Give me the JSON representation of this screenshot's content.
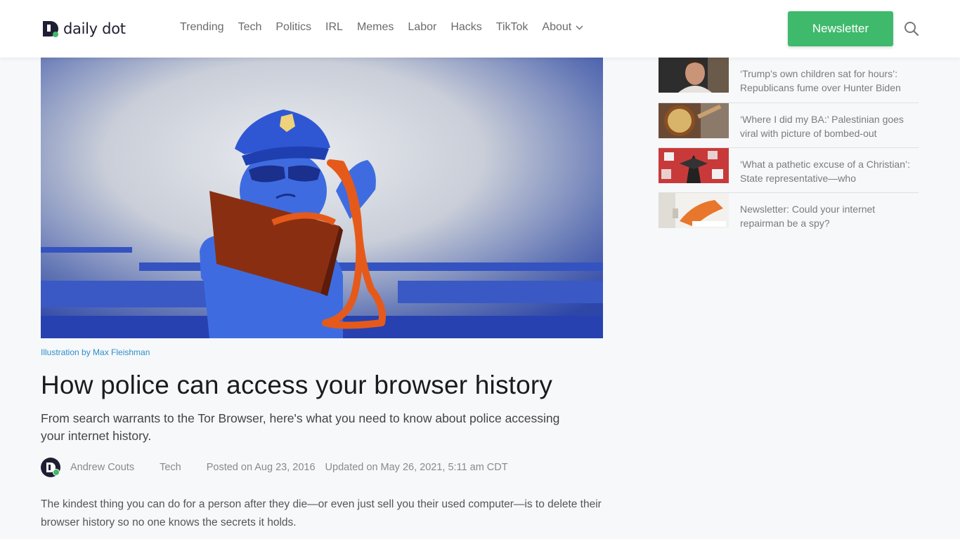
{
  "brand": {
    "name": "daily dot",
    "accent": "#3fb96b",
    "link_color": "#2c8fc9"
  },
  "nav": {
    "items": [
      "Trending",
      "Tech",
      "Politics",
      "IRL",
      "Memes",
      "Labor",
      "Hacks",
      "TikTok"
    ],
    "about_label": "About"
  },
  "header": {
    "newsletter_label": "Newsletter",
    "search_icon": "search-icon"
  },
  "article": {
    "hero_caption": "Illustration by Max Fleishman",
    "title": "How police can access your browser history",
    "subtitle": "From search warrants to the Tor Browser, here's what you need to know about police accessing your internet history.",
    "author": "Andrew Couts",
    "category": "Tech",
    "posted": "Posted on Aug 23, 2016",
    "updated": "Updated on May 26, 2021, 5:11 am CDT",
    "body": "The kindest thing you can do for a person after they die—or even just sell you their used computer—is to delete their browser history so no one knows the secrets it holds."
  },
  "sidebar": {
    "items": [
      {
        "text": "‘Trump’s own children sat for hours’: Republicans fume over Hunter Biden"
      },
      {
        "text": "‘Where I did my BA:’ Palestinian goes viral with picture of bombed-out"
      },
      {
        "text": "‘What a pathetic excuse of a Christian’: State representative—who"
      },
      {
        "text": "Newsletter: Could your internet repairman be a spy?"
      }
    ]
  }
}
